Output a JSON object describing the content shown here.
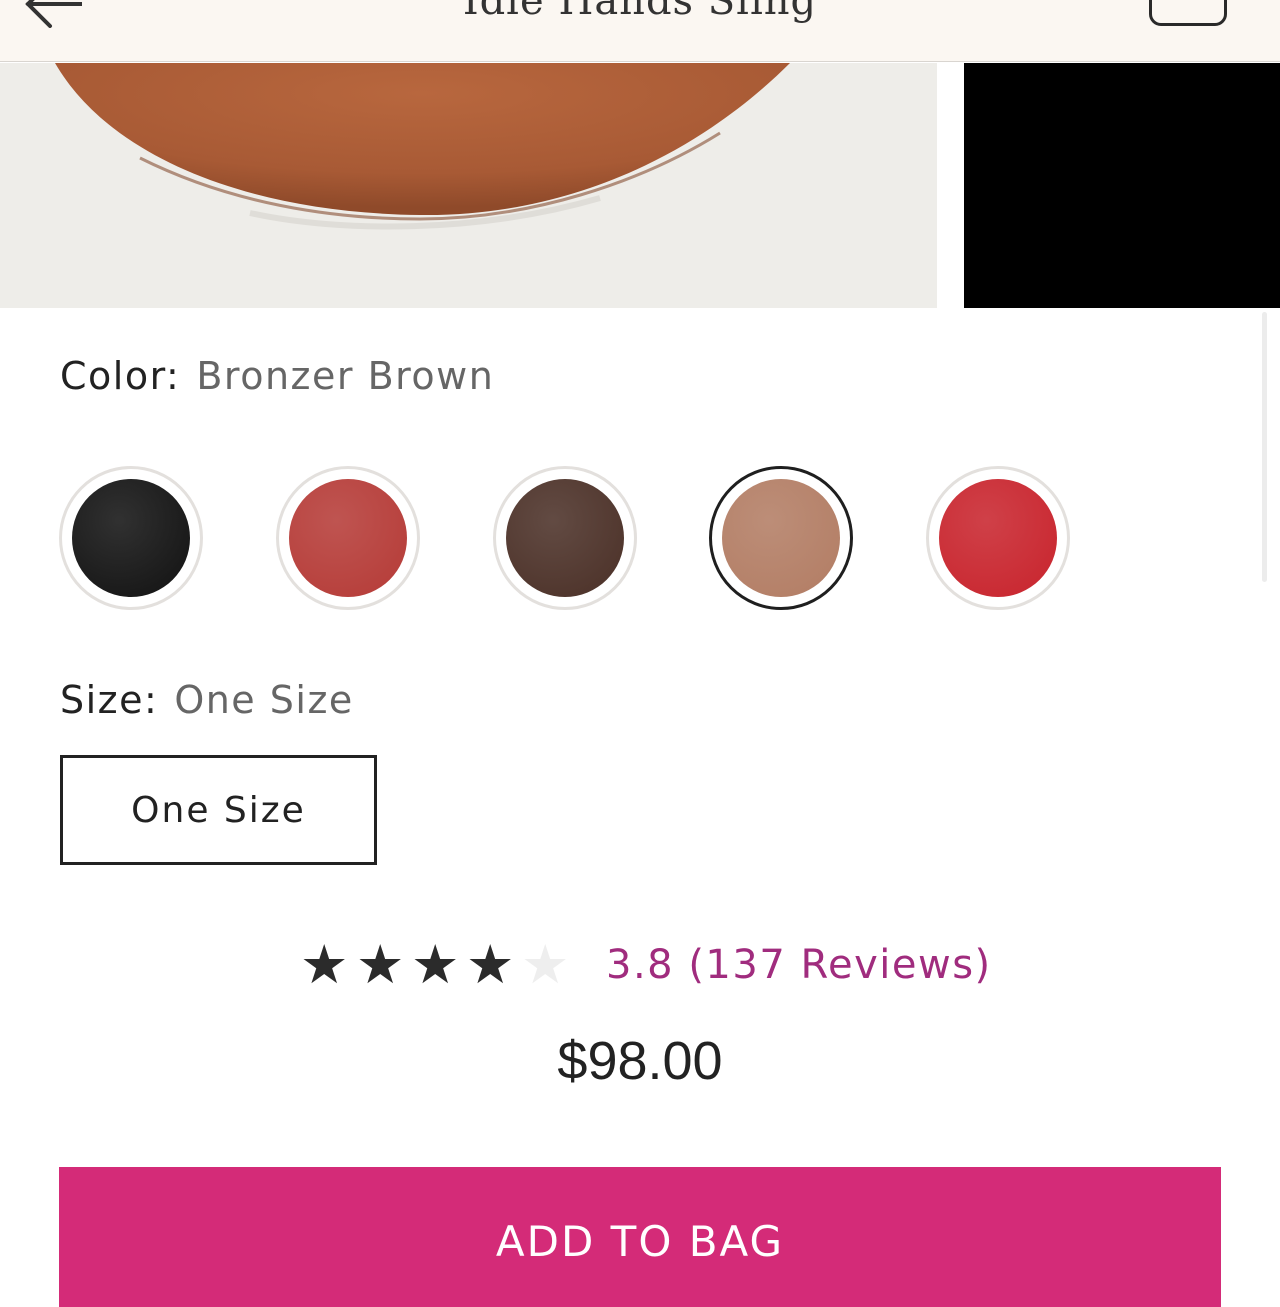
{
  "header": {
    "title": "Idle Hands Sling",
    "back_icon": "arrow-left-icon",
    "bag_icon": "shopping-bag-icon"
  },
  "color": {
    "label": "Color:",
    "value": "Bronzer Brown",
    "swatches": [
      {
        "name": "black",
        "hex": "#111111",
        "selected": false
      },
      {
        "name": "red-brown",
        "hex": "#b53a36",
        "selected": false
      },
      {
        "name": "dark-brown",
        "hex": "#4a2f26",
        "selected": false
      },
      {
        "name": "bronzer-brown",
        "hex": "#b27c63",
        "selected": true
      },
      {
        "name": "red",
        "hex": "#c8232c",
        "selected": false
      }
    ]
  },
  "size": {
    "label": "Size:",
    "value": "One Size",
    "option": "One Size"
  },
  "rating": {
    "score_text": "3.8 (137 Reviews)",
    "stars_filled": 4,
    "stars_total": 5
  },
  "price": "$98.00",
  "cta": {
    "add_to_bag": "ADD TO BAG",
    "color": "#d42b78"
  }
}
